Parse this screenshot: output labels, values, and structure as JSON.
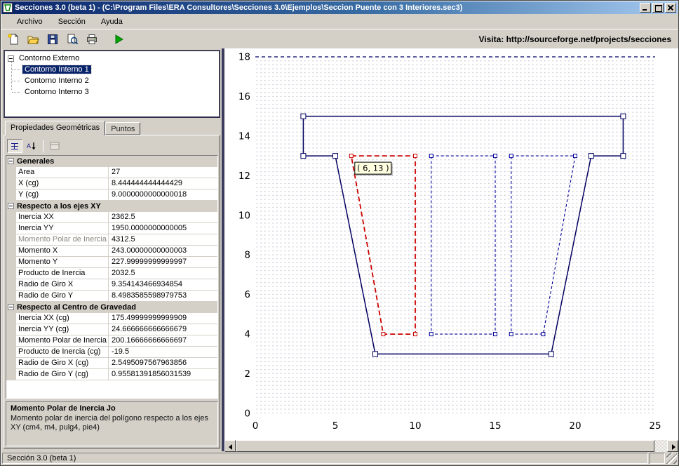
{
  "window": {
    "title": "Secciones 3.0 (beta 1)  - (C:\\Program Files\\ERA Consultores\\Secciones 3.0\\Ejemplos\\Seccion Puente con 3 Interiores.sec3)"
  },
  "menu": {
    "items": [
      "Archivo",
      "Sección",
      "Ayuda"
    ]
  },
  "toolbar": {
    "buttons": [
      "new-icon",
      "open-icon",
      "save-icon",
      "print-preview-icon",
      "print-icon",
      "run-icon"
    ],
    "visit_text": "Visita: http://sourceforge.net/projects/secciones"
  },
  "tree": {
    "root": "Contorno Externo",
    "children": [
      {
        "label": "Contorno Interno 1",
        "selected": true
      },
      {
        "label": "Contorno Interno 2",
        "selected": false
      },
      {
        "label": "Contorno Interno 3",
        "selected": false
      }
    ]
  },
  "tabs": [
    {
      "label": "Propiedades Geométricas",
      "active": true
    },
    {
      "label": "Puntos",
      "active": false
    }
  ],
  "property_grid": {
    "groups": [
      {
        "name": "Generales",
        "rows": [
          {
            "label": "Area",
            "value": "27"
          },
          {
            "label": "X (cg)",
            "value": "8.444444444444429"
          },
          {
            "label": "Y (cg)",
            "value": "9.0000000000000018"
          }
        ]
      },
      {
        "name": "Respecto a los ejes XY",
        "rows": [
          {
            "label": "Inercia XX",
            "value": "2362.5"
          },
          {
            "label": "Inercia YY",
            "value": "1950.0000000000005"
          },
          {
            "label": "Momento Polar de Inercia",
            "value": "4312.5",
            "muted": true
          },
          {
            "label": "Momento X",
            "value": "243.00000000000003"
          },
          {
            "label": "Momento Y",
            "value": "227.99999999999997"
          },
          {
            "label": "Producto de Inercia",
            "value": "2032.5"
          },
          {
            "label": "Radio de Giro X",
            "value": "9.354143466934854"
          },
          {
            "label": "Radio de Giro Y",
            "value": "8.4983585598979753"
          }
        ]
      },
      {
        "name": "Respecto al Centro de Gravedad",
        "rows": [
          {
            "label": "Inercia XX (cg)",
            "value": "175.49999999999909"
          },
          {
            "label": "Inercia YY (cg)",
            "value": "24.666666666666679"
          },
          {
            "label": "Momento Polar de Inercia",
            "value": "200.16666666666697"
          },
          {
            "label": "Producto de Inercia (cg)",
            "value": "-19.5"
          },
          {
            "label": "Radio de Giro X (cg)",
            "value": "2.5495097567963856"
          },
          {
            "label": "Radio de Giro Y (cg)",
            "value": "0.95581391856031539"
          }
        ]
      }
    ]
  },
  "description": {
    "title": "Momento Polar de Inercia Jo",
    "text": "Momento polar de inercia del polígono respecto a los ejes XY (cm4, m4, pulg4, pie4)"
  },
  "status_bar": {
    "text": "Sección 3.0 (beta 1)"
  },
  "chart_data": {
    "type": "line",
    "title": "",
    "xlabel": "",
    "ylabel": "",
    "xlim": [
      0,
      25
    ],
    "ylim": [
      0,
      18
    ],
    "xticks": [
      0,
      5,
      10,
      15,
      20,
      25
    ],
    "yticks": [
      0,
      2,
      4,
      6,
      8,
      10,
      12,
      14,
      16,
      18
    ],
    "grid": "dotted",
    "legend": "none",
    "top_border_dashed": true,
    "series": [
      {
        "name": "Contorno Externo",
        "color": "#000060",
        "line_style": "solid",
        "closed": true,
        "marker": "square",
        "points": [
          [
            3,
            15
          ],
          [
            23,
            15
          ],
          [
            23,
            13
          ],
          [
            21,
            13
          ],
          [
            18.5,
            3
          ],
          [
            7.5,
            3
          ],
          [
            5,
            13
          ],
          [
            3,
            13
          ]
        ]
      },
      {
        "name": "Contorno Interno 1",
        "color": "#cc0000",
        "line_style": "dashed",
        "closed": true,
        "marker": "square",
        "selected": true,
        "points": [
          [
            6,
            13
          ],
          [
            10,
            13
          ],
          [
            10,
            4
          ],
          [
            8,
            4
          ]
        ]
      },
      {
        "name": "Contorno Interno 2",
        "color": "#000099",
        "line_style": "dashed",
        "closed": true,
        "marker": "square",
        "points": [
          [
            11,
            13
          ],
          [
            15,
            13
          ],
          [
            15,
            4
          ],
          [
            11,
            4
          ]
        ]
      },
      {
        "name": "Contorno Interno 3",
        "color": "#000099",
        "line_style": "dashed",
        "closed": true,
        "marker": "square",
        "points": [
          [
            16,
            13
          ],
          [
            20,
            13
          ],
          [
            18,
            4
          ],
          [
            16,
            4
          ]
        ]
      }
    ],
    "tooltip": {
      "text": "( 6, 13 )",
      "anchor": [
        6,
        13
      ]
    }
  }
}
